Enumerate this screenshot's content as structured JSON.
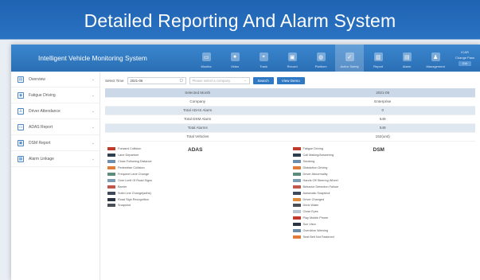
{
  "banner_title": "Detailed Reporting And Alarm System",
  "app_title": "Intelligent Vehicle Monitoring System",
  "nav": [
    {
      "label": "Monitor",
      "icon": "monitor-icon"
    },
    {
      "label": "Video",
      "icon": "video-icon"
    },
    {
      "label": "Track",
      "icon": "track-icon"
    },
    {
      "label": "Record",
      "icon": "record-icon"
    },
    {
      "label": "Platform",
      "icon": "platform-icon"
    },
    {
      "label": "Active Safety",
      "icon": "shield-icon"
    },
    {
      "label": "Report",
      "icon": "report-icon"
    },
    {
      "label": "Alarm",
      "icon": "alarm-icon"
    },
    {
      "label": "Management",
      "icon": "management-icon"
    }
  ],
  "user": {
    "name": "ICAR",
    "change_label": "Change Pass",
    "exit_label": "Exit"
  },
  "sidebar": [
    {
      "label": "Overview",
      "icon": "overview-icon"
    },
    {
      "label": "Fatigue Driving",
      "icon": "fatigue-icon"
    },
    {
      "label": "Driver Attendance",
      "icon": "driver-icon"
    },
    {
      "label": "ADAS Report",
      "icon": "adas-report-icon"
    },
    {
      "label": "DSM Report",
      "icon": "dsm-report-icon"
    },
    {
      "label": "Alarm Linkage",
      "icon": "alarm-linkage-icon"
    }
  ],
  "toolbar": {
    "select_time_label": "Select Time",
    "date_value": "2021-06",
    "company_placeholder": "Please select a company",
    "search_label": "Search",
    "view_demo_label": "View Demo"
  },
  "summary": [
    {
      "label": "Selected Month",
      "value": "2021-06"
    },
    {
      "label": "Company",
      "value": "Enterprise"
    },
    {
      "label": "Total ADAS Alarm",
      "value": "0"
    },
    {
      "label": "Total DSM Alarm",
      "value": "549"
    },
    {
      "label": "Total Alarms",
      "value": "549"
    },
    {
      "label": "Total Vehicles",
      "value": "152(unit)"
    }
  ],
  "adas": {
    "title": "ADAS",
    "items": [
      {
        "label": "Forward Collision",
        "color": "#c0392b"
      },
      {
        "label": "Lane Departure",
        "color": "#2c3e50"
      },
      {
        "label": "Close Following Distance",
        "color": "#6c8fb0"
      },
      {
        "label": "Pedestrian Collision",
        "color": "#e07b39"
      },
      {
        "label": "Frequent Lane Change",
        "color": "#5b8d7a"
      },
      {
        "label": "Over Limit Of Road Signs",
        "color": "#7d9db5"
      },
      {
        "label": "Barrier",
        "color": "#c0574a"
      },
      {
        "label": "Solid Line Change(adhs)",
        "color": "#3d4a5c"
      },
      {
        "label": "Road Sign Recognition",
        "color": "#2a3442"
      },
      {
        "label": "Snapshot",
        "color": "#4a4f57"
      }
    ]
  },
  "dsm": {
    "title": "DSM",
    "items": [
      {
        "label": "Fatigue Driving",
        "color": "#c0392b"
      },
      {
        "label": "Call Making/Answering",
        "color": "#2c3e50"
      },
      {
        "label": "Smoking",
        "color": "#6c8fb0"
      },
      {
        "label": "Distraction Driving",
        "color": "#e07b39"
      },
      {
        "label": "Driver Abnormality",
        "color": "#5b8d7a"
      },
      {
        "label": "Hands Off Steering Wheel",
        "color": "#7d9db5"
      },
      {
        "label": "Behavior Detection Failure",
        "color": "#c0574a"
      },
      {
        "label": "Automatic Snapshot",
        "color": "#3d4a5c"
      },
      {
        "label": "Driver Changed",
        "color": "#e08a3c"
      },
      {
        "label": "Drink Water",
        "color": "#4a4f57"
      },
      {
        "label": "Close Eyes",
        "color": "#b8c4d0"
      },
      {
        "label": "Play Mobile Phone",
        "color": "#c0392b"
      },
      {
        "label": "Sun Visor",
        "color": "#2a3442"
      },
      {
        "label": "Overdrive Warning",
        "color": "#6d8ca8"
      },
      {
        "label": "Seat Belt Not Fastened",
        "color": "#e07b39"
      }
    ]
  }
}
